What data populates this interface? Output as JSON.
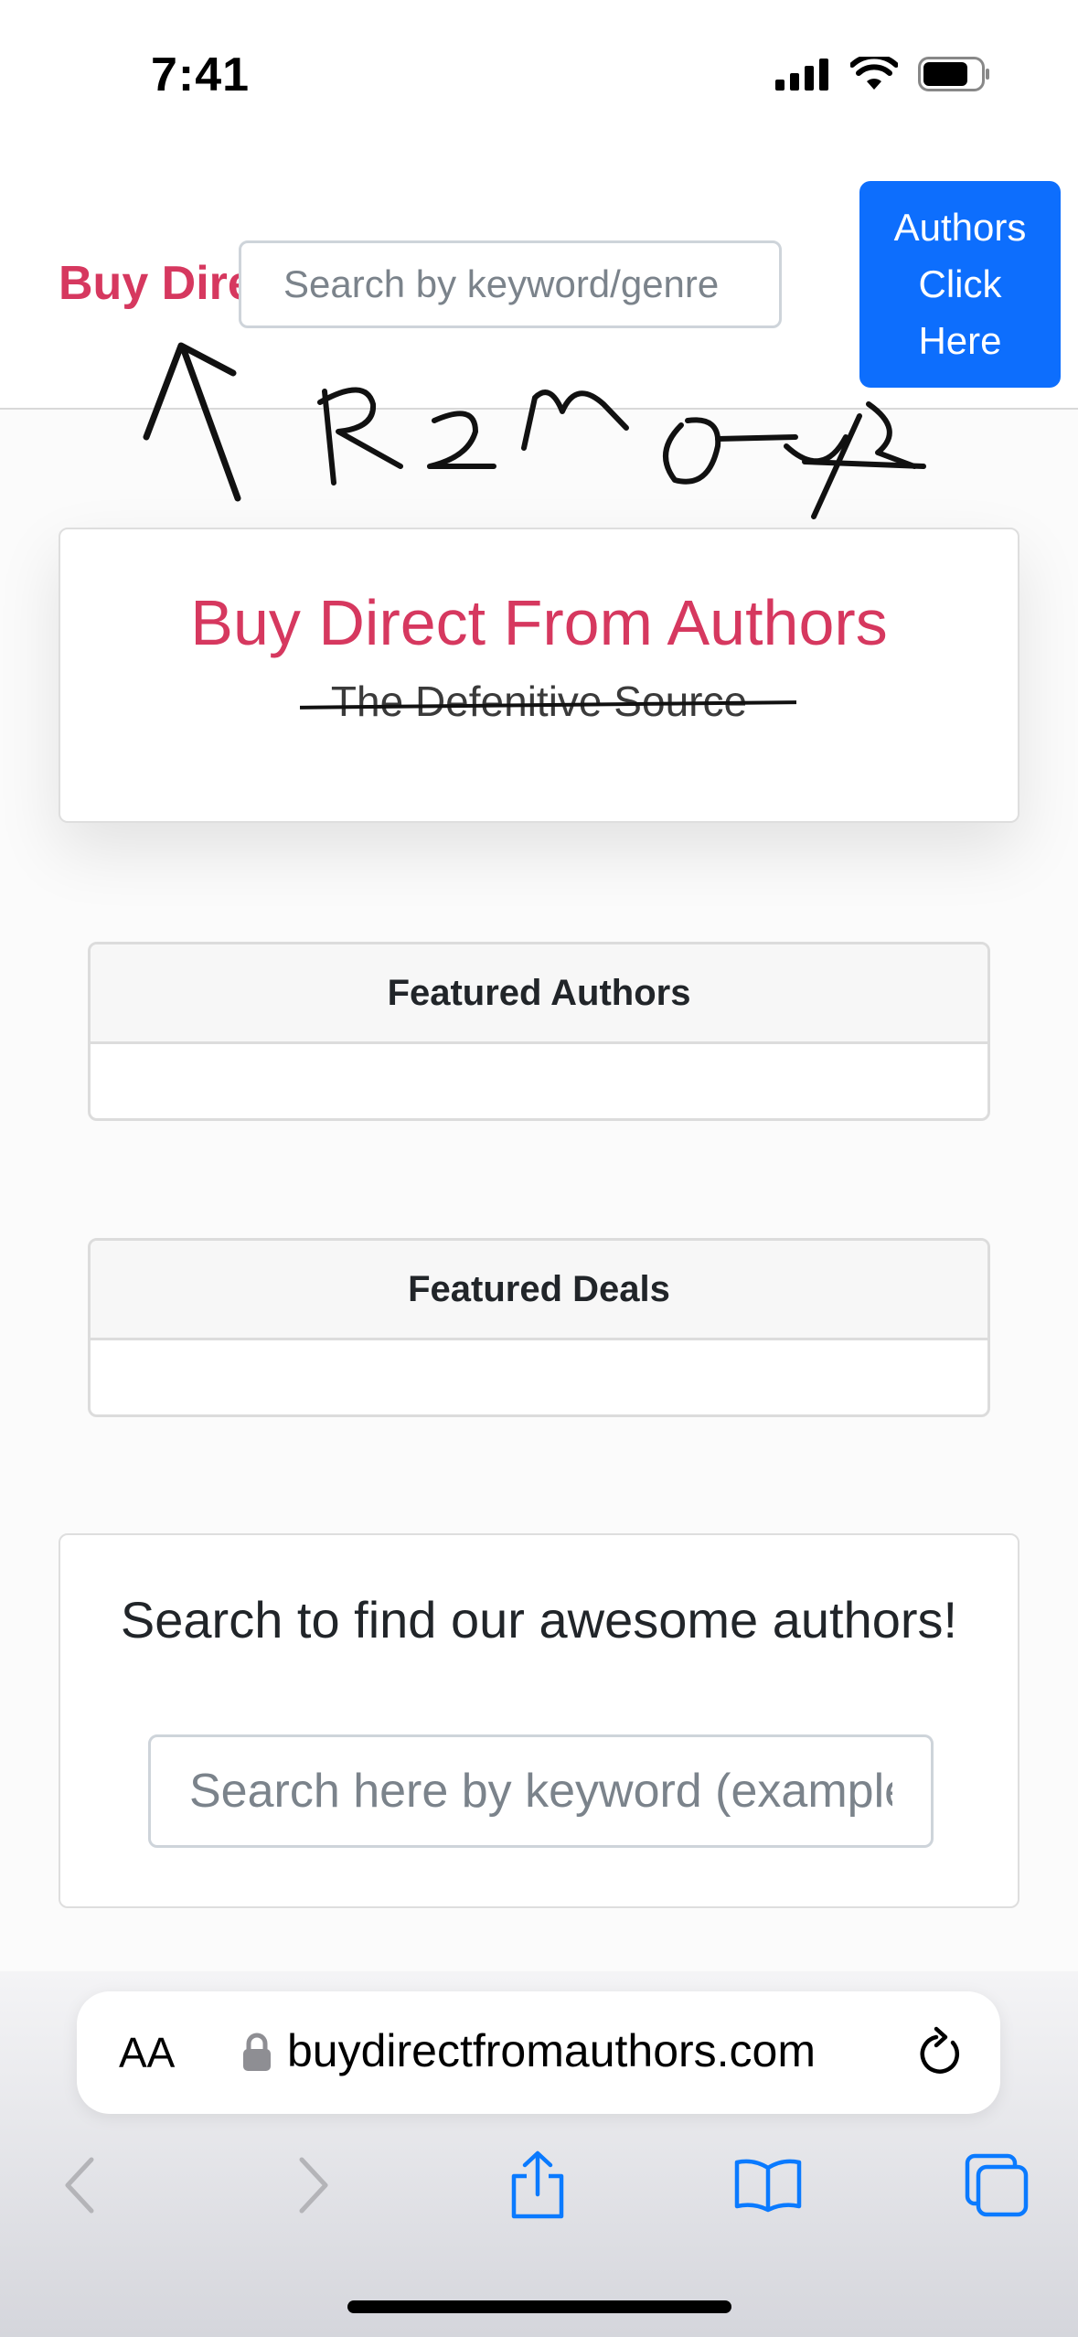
{
  "status_bar": {
    "time": "7:41"
  },
  "navbar": {
    "brand": "Buy Direct From Authors",
    "search_placeholder": "Search by keyword/genre",
    "authors_button": "Authors\nClick\nHere"
  },
  "annotation": {
    "text": "Remove",
    "icon": "arrow-up-icon"
  },
  "hero": {
    "title": "Buy Direct From Authors",
    "subtitle": "The Defenitive Source"
  },
  "featured": [
    {
      "title": "Featured Authors"
    },
    {
      "title": "Featured Deals"
    }
  ],
  "search_section": {
    "heading": "Search to find our awesome authors!",
    "placeholder": "Search here by keyword (example"
  },
  "safari": {
    "text_size_label": "AA",
    "url": "buydirectfromauthors.com",
    "icons": [
      "lock-icon",
      "reload-icon",
      "back-icon",
      "forward-icon",
      "share-icon",
      "bookmarks-icon",
      "tabs-icon"
    ]
  },
  "colors": {
    "brand": "#d6385f",
    "primary_button": "#0d6efd",
    "ios_blue": "#0a7aff"
  }
}
